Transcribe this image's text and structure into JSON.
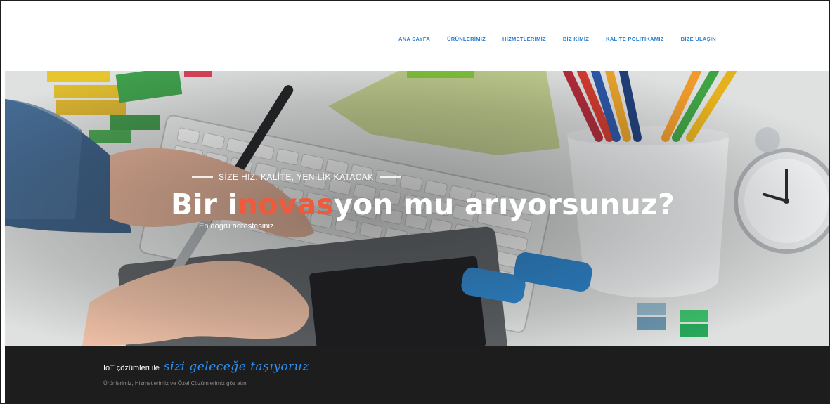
{
  "nav": {
    "items": [
      {
        "label": "ANA SAYFA"
      },
      {
        "label": "ÜRÜNLERİMİZ"
      },
      {
        "label": "HİZMETLERİMİZ"
      },
      {
        "label": "BİZ KİMİZ"
      },
      {
        "label": "KALİTE POLİTİKAMIZ"
      },
      {
        "label": "BİZE ULAŞIN"
      }
    ]
  },
  "hero": {
    "eyebrow": "SİZE HIZ, KALİTE, YENİLİK KATACAK",
    "headline_part1": "Bir i",
    "headline_accent": "novas",
    "headline_part2": "yon mu arıyorsunuz?",
    "subline": "En doğru adrestesiniz.",
    "accent_color": "#ee5a3c"
  },
  "footer": {
    "lead": "IoT çözümleri ile",
    "script": "sizi geleceğe taşıyoruz",
    "tagline": "Ürünlerimiz, Hizmetlerimiz ve Özel Çözümlerimiz göz atın",
    "script_color": "#2e8ff0"
  }
}
